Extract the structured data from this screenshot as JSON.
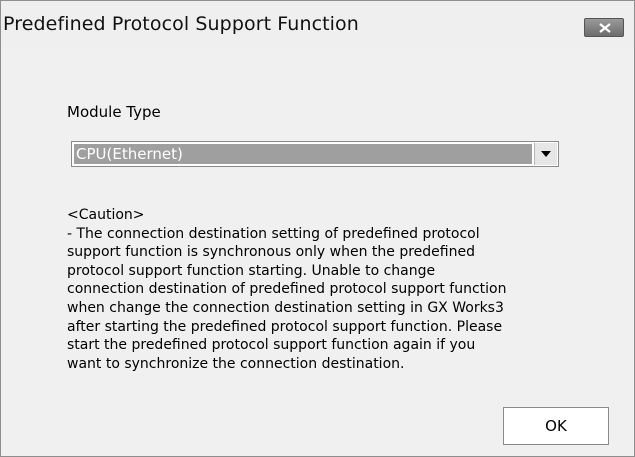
{
  "window": {
    "title": "Predefined Protocol Support Function",
    "close_icon": "close-icon"
  },
  "module_type": {
    "label": "Module Type",
    "selected_value": "CPU(Ethernet)",
    "dropdown_icon": "chevron-down-icon"
  },
  "caution": {
    "lines": [
      "<Caution>",
      "- The connection destination setting of predefined protocol",
      "support function is synchronous only when the predefined",
      "protocol support function starting. Unable to change",
      "connection destination of predefined protocol support function",
      "when change the connection destination setting in GX Works3",
      "after starting the predefined protocol support function. Please",
      "start the predefined protocol support function again if you",
      "want to synchronize the connection destination."
    ]
  },
  "buttons": {
    "ok_label": "OK"
  }
}
